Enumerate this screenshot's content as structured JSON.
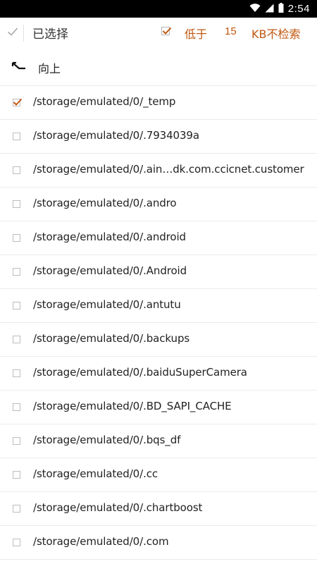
{
  "status_bar": {
    "time": "2:54",
    "icons": [
      "wifi-icon",
      "signal-icon",
      "battery-icon"
    ]
  },
  "toolbar": {
    "title": "已选择",
    "filter_checked": true,
    "filter_prefix": "低于",
    "filter_value": "15",
    "filter_suffix": "KB不检索"
  },
  "up": {
    "label": "向上"
  },
  "colors": {
    "accent": "#c1570e",
    "text": "#222222",
    "divider": "#ececec",
    "statusbar": "#000000"
  },
  "items": [
    {
      "path": "/storage/emulated/0/_temp",
      "checked": true
    },
    {
      "path": "/storage/emulated/0/.7934039a",
      "checked": false
    },
    {
      "path": "/storage/emulated/0/.ain…dk.com.ccicnet.customer",
      "checked": false
    },
    {
      "path": "/storage/emulated/0/.andro",
      "checked": false
    },
    {
      "path": "/storage/emulated/0/.android",
      "checked": false
    },
    {
      "path": "/storage/emulated/0/.Android",
      "checked": false
    },
    {
      "path": "/storage/emulated/0/.antutu",
      "checked": false
    },
    {
      "path": "/storage/emulated/0/.backups",
      "checked": false
    },
    {
      "path": "/storage/emulated/0/.baiduSuperCamera",
      "checked": false
    },
    {
      "path": "/storage/emulated/0/.BD_SAPI_CACHE",
      "checked": false
    },
    {
      "path": "/storage/emulated/0/.bqs_df",
      "checked": false
    },
    {
      "path": "/storage/emulated/0/.cc",
      "checked": false
    },
    {
      "path": "/storage/emulated/0/.chartboost",
      "checked": false
    },
    {
      "path": "/storage/emulated/0/.com",
      "checked": false
    }
  ]
}
